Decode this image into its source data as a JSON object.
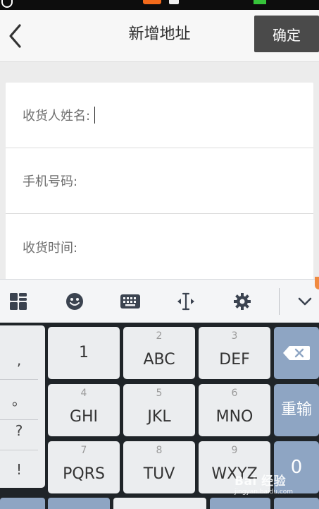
{
  "header": {
    "title": "新增地址",
    "confirm_label": "确定"
  },
  "form": {
    "fields": [
      {
        "label": "收货人姓名:"
      },
      {
        "label": "手机号码:"
      },
      {
        "label": "收货时间:"
      }
    ]
  },
  "keyboard": {
    "symbols": [
      ",",
      "。",
      "?",
      "!"
    ],
    "keys": [
      {
        "num": "",
        "letters": "1"
      },
      {
        "num": "2",
        "letters": "ABC"
      },
      {
        "num": "3",
        "letters": "DEF"
      },
      {
        "num": "4",
        "letters": "GHI"
      },
      {
        "num": "5",
        "letters": "JKL"
      },
      {
        "num": "6",
        "letters": "MNO"
      },
      {
        "num": "7",
        "letters": "PQRS"
      },
      {
        "num": "8",
        "letters": "TUV"
      },
      {
        "num": "9",
        "letters": "WXYZ"
      }
    ],
    "reenter_label": "重输",
    "zero_label": "0"
  },
  "watermark": {
    "main": "Bai 经验",
    "sub": "jingyan.baidu.com"
  },
  "colors": {
    "accent_key": "#8ea5c3",
    "confirm_bg": "#4a4a4a"
  }
}
